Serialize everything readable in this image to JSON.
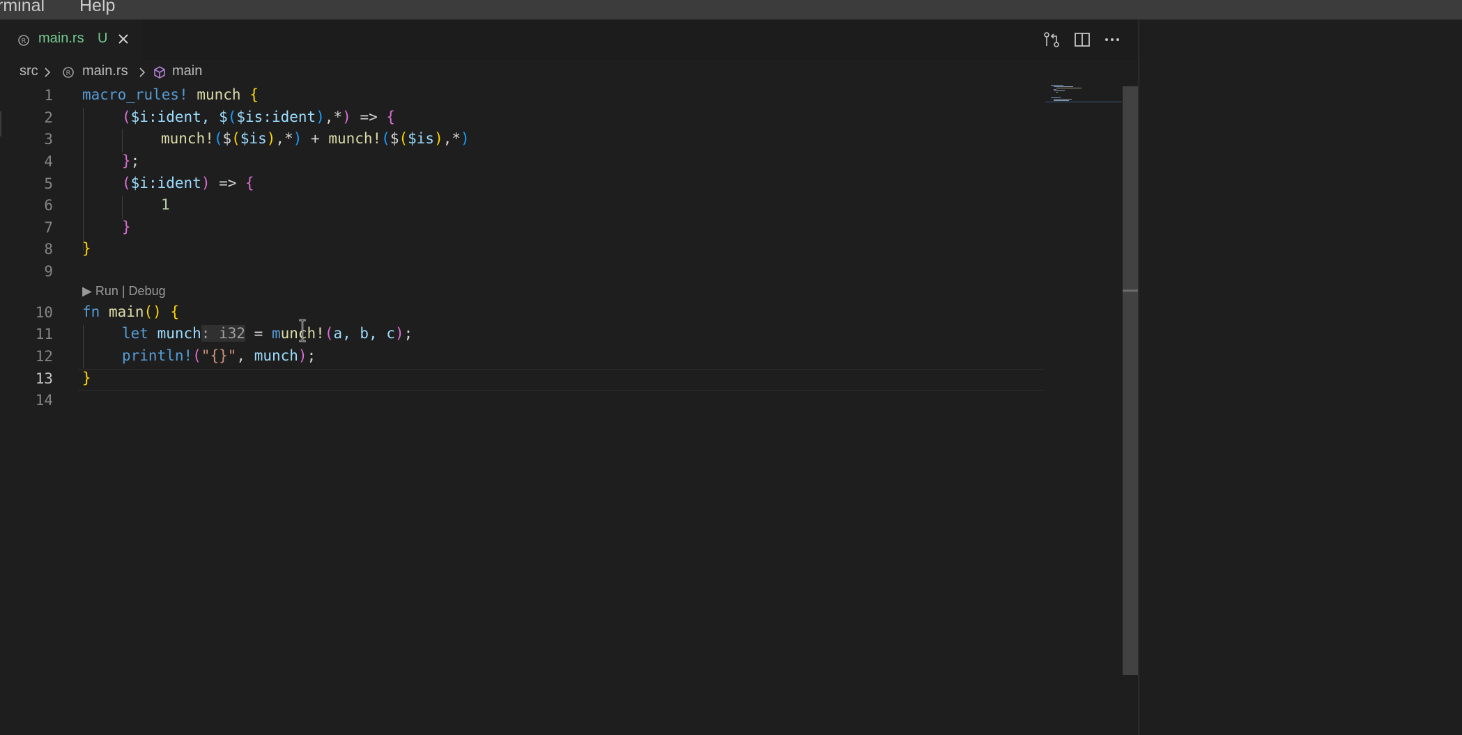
{
  "menubar": {
    "items": [
      "rminal",
      "Help"
    ]
  },
  "tab": {
    "filename": "main.rs",
    "status": "U",
    "icon": "rust-file-icon"
  },
  "tab_actions": [
    "open-changes-icon",
    "split-editor-icon",
    "more-actions-icon"
  ],
  "breadcrumb": {
    "folder": "src",
    "file": "main.rs",
    "symbol": "main"
  },
  "codelens": "▶ Run | Debug",
  "line_numbers": [
    "1",
    "2",
    "3",
    "4",
    "5",
    "6",
    "7",
    "8",
    "9",
    "10",
    "11",
    "12",
    "13",
    "14"
  ],
  "active_line": "13",
  "inlay_hint": ": i32",
  "colors": {
    "background": "#1e1e1e",
    "tab_modified": "#73c991",
    "keyword": "#569cd6",
    "function": "#dcdcaa",
    "variable": "#9cdcfe",
    "number": "#b5cea8",
    "string": "#ce9178",
    "bracket_gold": "#ffd700",
    "bracket_orchid": "#da70d6",
    "bracket_blue": "#179fff"
  },
  "code": {
    "l1": {
      "kw": "macro_rules!",
      "name": " munch ",
      "b": "{"
    },
    "l2": {
      "p1": "(",
      "t1": "$i:ident, $",
      "p2": "(",
      "t2": "$is:ident",
      "p3": ")",
      "t3": ",*",
      "p4": ")",
      "arrow": " => ",
      "b": "{"
    },
    "l3": {
      "m1": "munch!",
      "p1": "(",
      "t1": "$",
      "p2": "(",
      "t2": "$is",
      "p3": ")",
      "t3": ",*",
      "p4": ")",
      "plus": " + ",
      "m2": "munch!",
      "q1": "(",
      "u1": "$",
      "q2": "(",
      "u2": "$is",
      "q3": ")",
      "u3": ",*",
      "q4": ")"
    },
    "l4": {
      "b": "}",
      "semi": ";"
    },
    "l5": {
      "p1": "(",
      "t1": "$i:ident",
      "p2": ")",
      "arrow": " => ",
      "b": "{"
    },
    "l6": {
      "num": "1"
    },
    "l7": {
      "b": "}"
    },
    "l8": {
      "b": "}"
    },
    "l10": {
      "kw": "fn",
      "name": " main",
      "p": "()",
      "sp": " ",
      "b": "{"
    },
    "l11": {
      "kw": "let",
      "var": " munch",
      "eq": " = ",
      "m1": "m",
      "m2": "unch!",
      "p1": "(",
      "args": "a, b, c",
      "p2": ")",
      "semi": ";"
    },
    "l12": {
      "m": "println!",
      "p1": "(",
      "str": "\"{}\"",
      "comma": ", ",
      "var": "munch",
      "p2": ")",
      "semi": ";"
    },
    "l13": {
      "b": "}"
    }
  }
}
